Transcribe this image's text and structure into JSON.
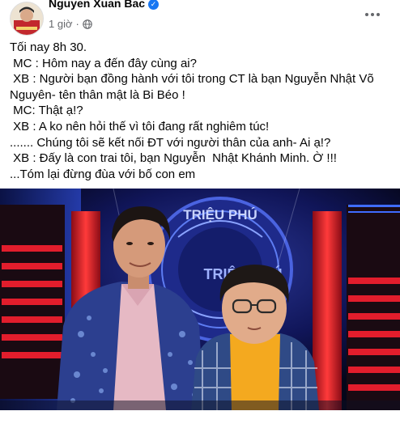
{
  "post": {
    "author": "Nguyen Xuan Bac",
    "time": "1 giờ",
    "verified": true,
    "privacy_icon": "globe-icon",
    "lines": [
      "Tối nay 8h 30.",
      " MC : Hôm nay a đến đây cùng ai?",
      " XB : Người bạn đồng hành với tôi trong CT là bạn Nguyễn Nhật Võ Nguyên- tên thân mật là Bi Béo !",
      " MC: Thật ạ!?",
      " XB : A ko nên hỏi thế vì tôi đang rất nghiêm túc!",
      "....... Chúng tôi sẽ kết nối ĐT với người thân của anh- Ai ạ!?",
      " XB : Đấy là con trai tôi, bạn Nguyễn  Nhật Khánh Minh. Ờ !!!",
      "...Tóm lại đừng đùa với bố con em"
    ]
  },
  "photo": {
    "logo_text_top": "TRIỆU PHÚ",
    "logo_text_bottom": "TRIỆU PHÚ"
  },
  "colors": {
    "verified": "#1877f2",
    "meta": "#65676b",
    "stage_red": "#d8192a"
  }
}
